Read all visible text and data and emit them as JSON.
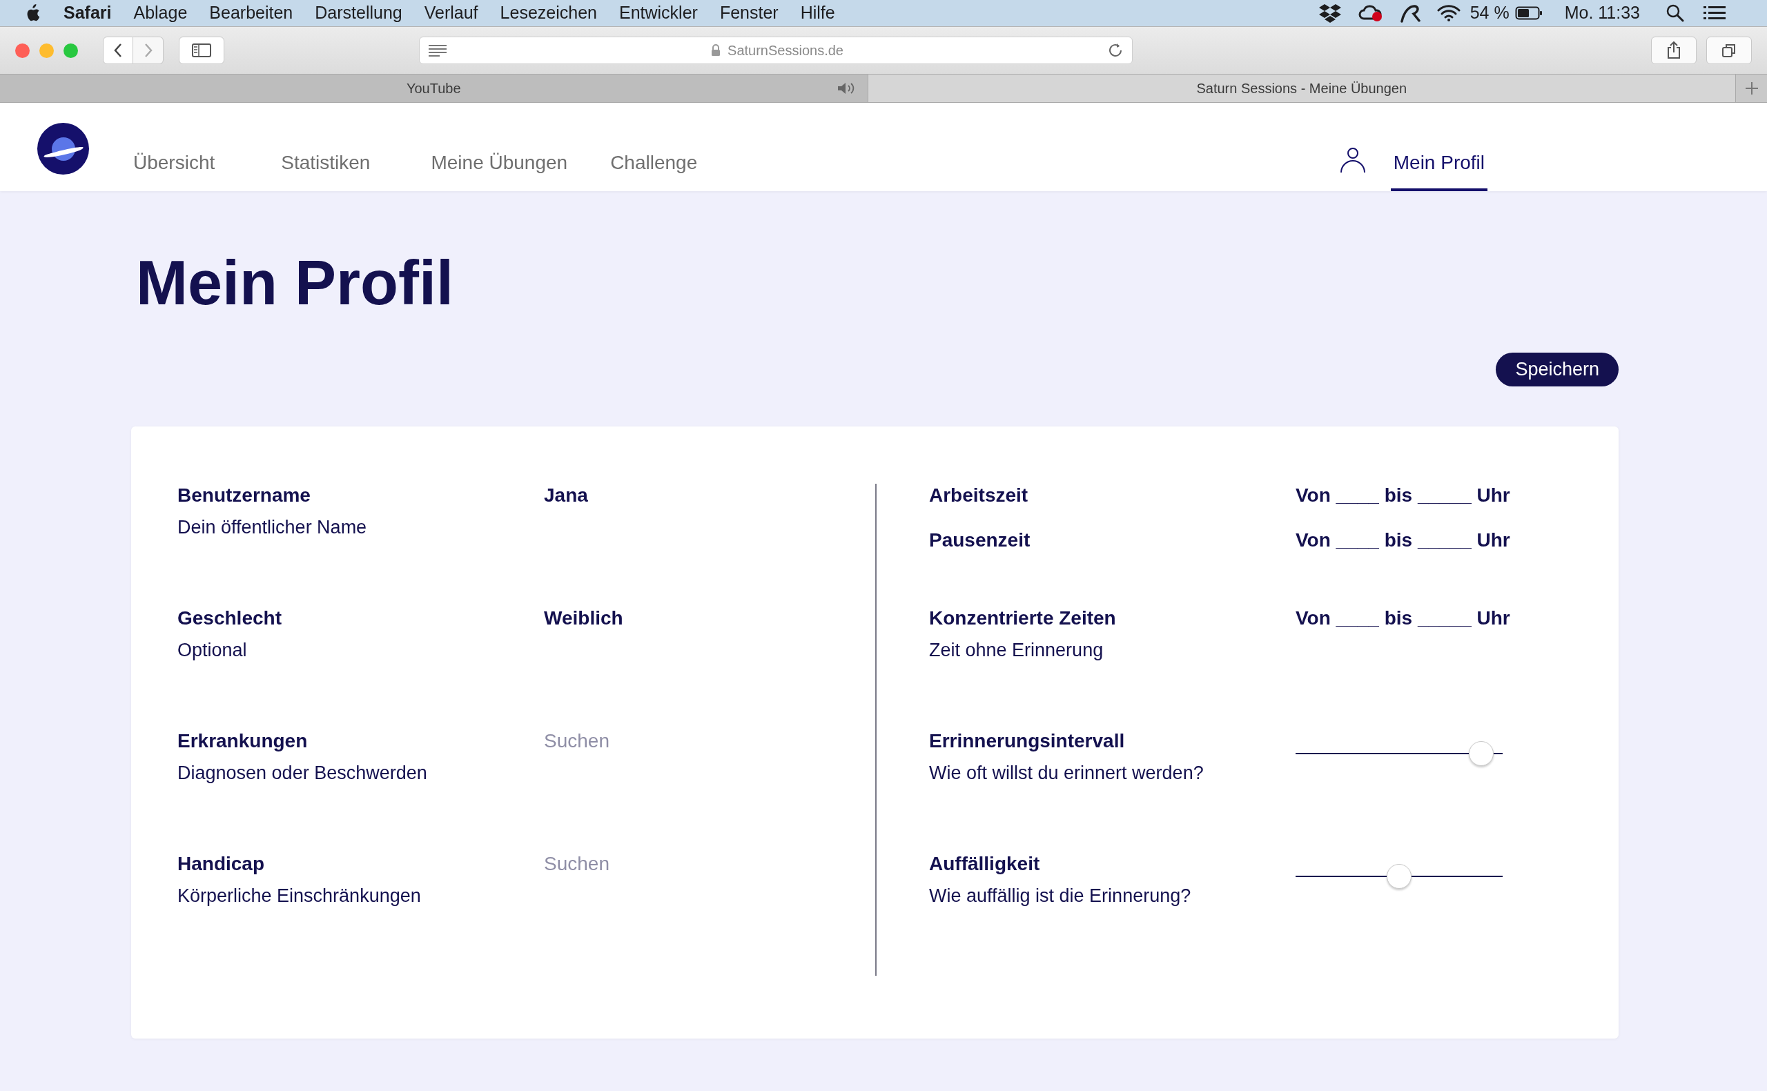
{
  "menubar": {
    "app": "Safari",
    "menus": [
      "Ablage",
      "Bearbeiten",
      "Darstellung",
      "Verlauf",
      "Lesezeichen",
      "Entwickler",
      "Fenster",
      "Hilfe"
    ],
    "battery": "54 %",
    "clock": "Mo. 11:33"
  },
  "browser": {
    "url": "SaturnSessions.de",
    "tabs": [
      {
        "title": "YouTube",
        "selected": false,
        "audio": true
      },
      {
        "title": "Saturn Sessions - Meine Übungen",
        "selected": true,
        "audio": false
      }
    ]
  },
  "nav": {
    "items": [
      {
        "label": "Übersicht",
        "selected": false
      },
      {
        "label": "Statistiken",
        "selected": false
      },
      {
        "label": "Meine Übungen",
        "selected": false
      },
      {
        "label": "Challenge",
        "selected": false
      }
    ],
    "profile": {
      "label": "Mein Profil",
      "selected": true
    }
  },
  "page_title": "Mein Profil",
  "save_button": "Speichern",
  "left_fields": [
    {
      "label": "Benutzername",
      "hint": "Dein öffentlicher Name",
      "kind": "text",
      "value": "Jana"
    },
    {
      "label": "Geschlecht",
      "hint": "Optional",
      "kind": "text",
      "value": "Weiblich"
    },
    {
      "label": "Erkrankungen",
      "hint": "Diagnosen oder Beschwerden",
      "kind": "search",
      "placeholder": "Suchen"
    },
    {
      "label": "Handicap",
      "hint": "Körperliche Einschränkungen",
      "kind": "search",
      "placeholder": "Suchen"
    }
  ],
  "right_groups": [
    [
      {
        "label": "Arbeitszeit",
        "kind": "time",
        "value": "Von ____ bis _____ Uhr"
      },
      {
        "label": "Pausenzeit",
        "kind": "time",
        "value": "Von ____ bis _____ Uhr"
      }
    ],
    [
      {
        "label": "Konzentrierte Zeiten",
        "hint": "Zeit ohne Erinnerung",
        "kind": "time",
        "value": "Von ____ bis _____ Uhr"
      }
    ],
    [
      {
        "label": "Errinnerungsintervall",
        "hint": "Wie oft willst du erinnert werden?",
        "kind": "slider",
        "level": 0.95
      }
    ],
    [
      {
        "label": "Auffälligkeit",
        "hint": "Wie auffällig ist die Erinnerung?",
        "kind": "slider",
        "level": 0.5
      }
    ]
  ]
}
